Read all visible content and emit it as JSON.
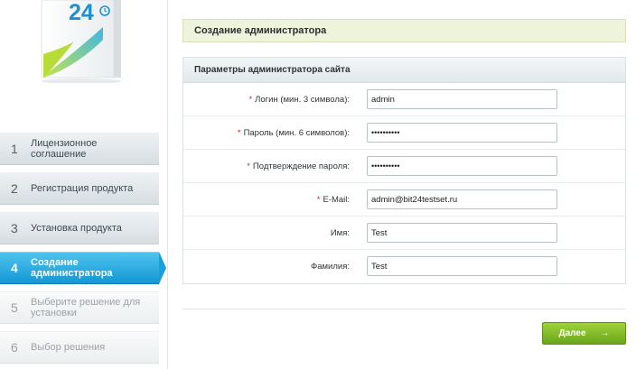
{
  "sidebar": {
    "logo_text": "24",
    "steps": [
      {
        "num": "1",
        "label": "Лицензионное соглашение",
        "state": "done"
      },
      {
        "num": "2",
        "label": "Регистрация продукта",
        "state": "done"
      },
      {
        "num": "3",
        "label": "Установка продукта",
        "state": "done"
      },
      {
        "num": "4",
        "label": "Создание администратора",
        "state": "active"
      },
      {
        "num": "5",
        "label": "Выберите решение для установки",
        "state": "todo"
      },
      {
        "num": "6",
        "label": "Выбор решения",
        "state": "todo"
      }
    ]
  },
  "main": {
    "title": "Создание администратора",
    "panel_title": "Параметры администратора сайта",
    "fields": [
      {
        "label": "Логин (мин. 3 символа):",
        "required": "*",
        "value": "admin"
      },
      {
        "label": "Пароль (мин. 6 символов):",
        "required": "*",
        "value": "••••••••••"
      },
      {
        "label": "Подтверждение пароля:",
        "required": "*",
        "value": "••••••••••"
      },
      {
        "label": "E-Mail:",
        "required": "*",
        "value": "admin@bit24testset.ru"
      },
      {
        "label": "Имя:",
        "required": "",
        "value": "Test"
      },
      {
        "label": "Фамилия:",
        "required": "",
        "value": "Test"
      }
    ],
    "next_label": "Далее",
    "next_arrow": "→"
  },
  "colors": {
    "accent_active": "#1a9fd8",
    "button_green": "#7db52a",
    "title_bar_bg": "#eef3dc",
    "required": "#d9261c"
  }
}
